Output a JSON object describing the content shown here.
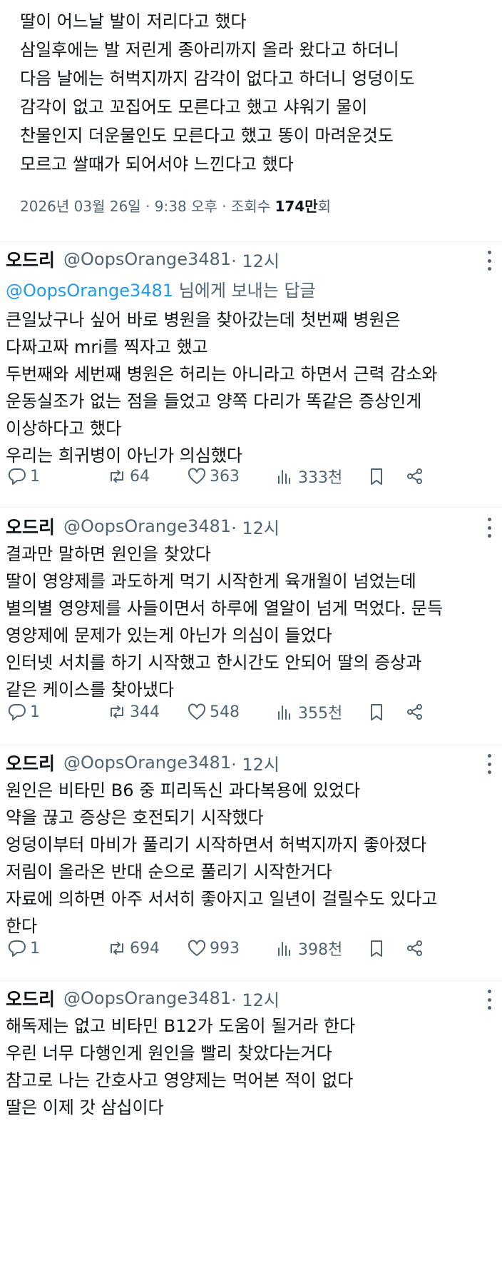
{
  "original_post": {
    "lines": [
      "딸이 어느날 발이 저리다고 했다",
      "삼일후에는 발 저린게 종아리까지 올라 왔다고 하더니",
      "다음 날에는 허벅지까지 감각이 없다고 하더니 엉덩이도",
      "감각이 없고 꼬집어도 모른다고 했고 샤워기 물이",
      "찬물인지 더운물인도 모른다고 했고 똥이 마려운것도",
      "모르고 쌀때가 되어서야 느낀다고 했다"
    ],
    "meta_prefix": "2026년 03월 26일 · 9:38 오후 · 조회수 ",
    "meta_views": "174만",
    "meta_suffix": "회"
  },
  "replies": [
    {
      "name": "오드리",
      "handle": "@OopsOrange3481",
      "time": " · 12시",
      "replying_mention": "@OopsOrange3481",
      "replying_suffix": " 님에게 보내는 답글",
      "lines": [
        "큰일났구나 싶어 바로 병원을 찾아갔는데 첫번째 병원은",
        "다짜고짜 mri를 찍자고 했고",
        "두번째와 세번째 병원은 허리는 아니라고 하면서 근력 감소와",
        "운동실조가 없는 점을 들었고 양쪽 다리가 똑같은 증상인게",
        "이상하다고 했다",
        "우리는 희귀병이 아닌가 의심했다"
      ],
      "replies_count": "1",
      "retweets": "64",
      "likes": "363",
      "views": "333천"
    },
    {
      "name": "오드리",
      "handle": "@OopsOrange3481",
      "time": " · 12시",
      "lines": [
        "결과만 말하면 원인을 찾았다",
        "딸이 영양제를 과도하게 먹기 시작한게 육개월이 넘었는데",
        "별의별 영양제를 사들이면서 하루에 열알이 넘게 먹었다. 문득",
        "영양제에 문제가 있는게 아닌가 의심이 들었다",
        "인터넷 서치를 하기 시작했고 한시간도 안되어 딸의 증상과",
        "같은 케이스를 찾아냈다"
      ],
      "replies_count": "1",
      "retweets": "344",
      "likes": "548",
      "views": "355천"
    },
    {
      "name": "오드리",
      "handle": "@OopsOrange3481",
      "time": " · 12시",
      "lines": [
        "원인은 비타민 B6 중 피리독신 과다복용에 있었다",
        "약을 끊고 증상은 호전되기 시작했다",
        "엉덩이부터 마비가 풀리기 시작하면서 허벅지까지 좋아졌다",
        "저림이 올라온 반대 순으로 풀리기 시작한거다",
        "자료에 의하면 아주 서서히 좋아지고 일년이 걸릴수도 있다고",
        "한다"
      ],
      "replies_count": "1",
      "retweets": "694",
      "likes": "993",
      "views": "398천"
    },
    {
      "name": "오드리",
      "handle": "@OopsOrange3481",
      "time": " · 12시",
      "lines": [
        "해독제는 없고 비타민 B12가 도움이 될거라 한다",
        "우린 너무 다행인게 원인을 빨리 찾았다는거다",
        "참고로 나는 간호사고 영양제는 먹어본 적이 없다",
        "딸은 이제 갓 삼십이다"
      ]
    }
  ],
  "icons": {
    "reply": "reply-icon",
    "retweet": "retweet-icon",
    "like": "heart-icon",
    "views": "views-icon",
    "bookmark": "bookmark-icon",
    "share": "share-icon",
    "more": "more-icon"
  },
  "colors": {
    "text": "#0f1419",
    "secondary": "#536471",
    "link": "#1d9bf0",
    "divider": "#eff3f4"
  }
}
